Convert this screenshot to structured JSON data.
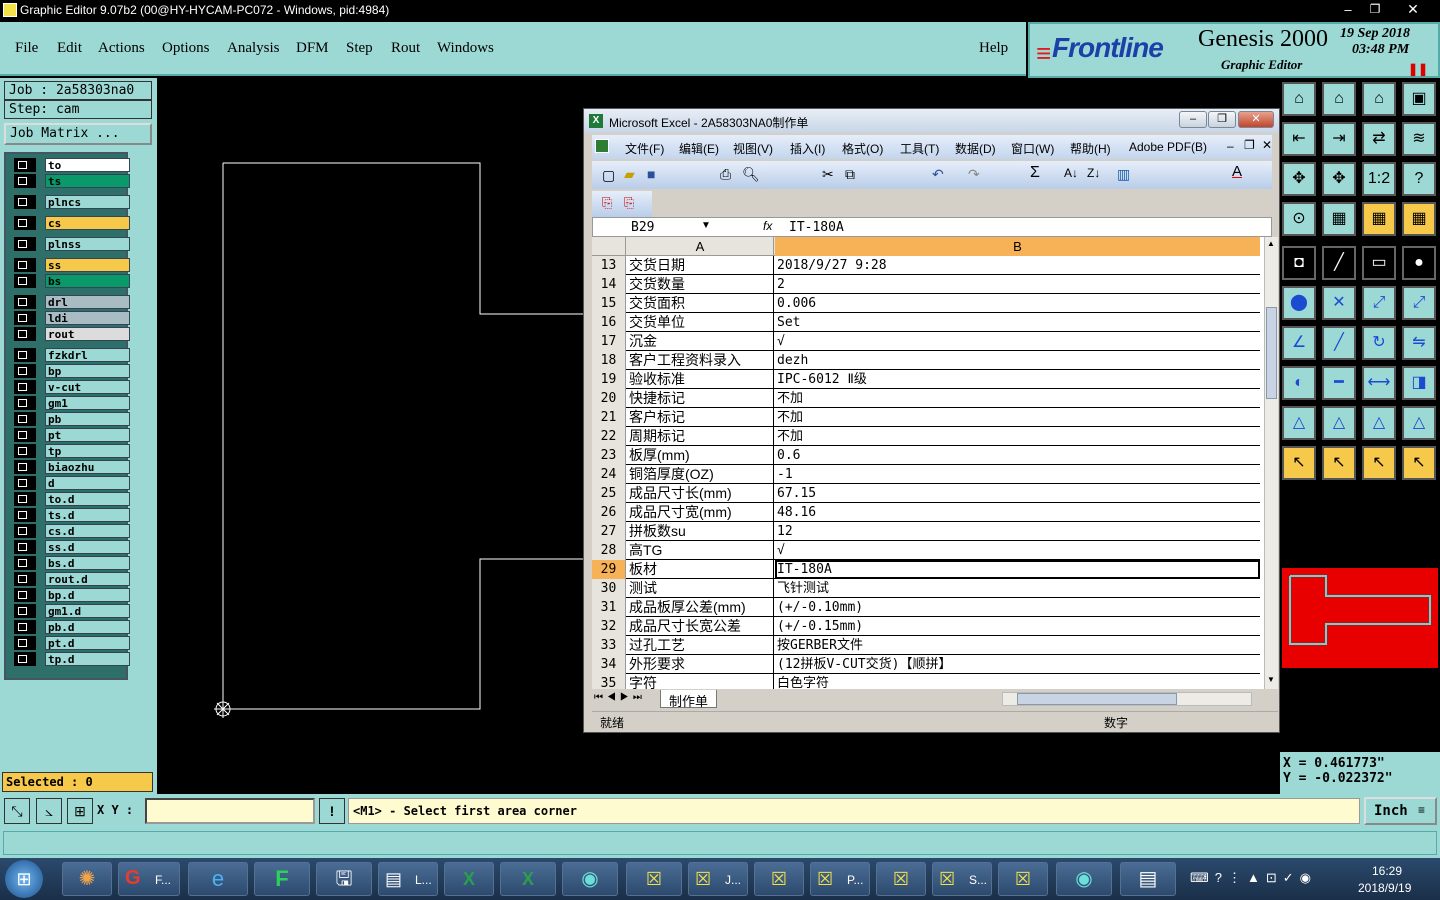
{
  "window": {
    "title": "Graphic Editor 9.07b2 (00@HY-HYCAM-PC072 - Windows, pid:4984)"
  },
  "menu": {
    "items": [
      "File",
      "Edit",
      "Actions",
      "Options",
      "Analysis",
      "DFM",
      "Step",
      "Rout",
      "Windows"
    ],
    "help": "Help"
  },
  "brand": {
    "logo": "Frontline",
    "product": "Genesis 2000",
    "subtitle": "Graphic Editor",
    "date": "19 Sep 2018",
    "time": "03:48 PM"
  },
  "job": {
    "job_label": "Job : 2a58303na0",
    "step_label": "Step: cam",
    "matrix_button": "Job Matrix ..."
  },
  "layers": [
    {
      "name": "to",
      "color": "#ffffff"
    },
    {
      "name": "ts",
      "color": "#0a9a6a"
    },
    {
      "name": "plncs",
      "color": "#9cd9d4"
    },
    {
      "name": "cs",
      "color": "#f7c94b"
    },
    {
      "name": "plnss",
      "color": "#9cd9d4"
    },
    {
      "name": "ss",
      "color": "#f7c94b"
    },
    {
      "name": "bs",
      "color": "#0a9a6a"
    },
    {
      "name": "drl",
      "color": "#a9bcc4"
    },
    {
      "name": "ldi",
      "color": "#a9bcc4"
    },
    {
      "name": "rout",
      "color": "#dcdcdc"
    },
    {
      "name": "fzkdrl",
      "color": "#9cd9d4"
    },
    {
      "name": "bp",
      "color": "#9cd9d4"
    },
    {
      "name": "v-cut",
      "color": "#9cd9d4"
    },
    {
      "name": "gm1",
      "color": "#9cd9d4"
    },
    {
      "name": "pb",
      "color": "#9cd9d4"
    },
    {
      "name": "pt",
      "color": "#9cd9d4"
    },
    {
      "name": "tp",
      "color": "#9cd9d4"
    },
    {
      "name": "biaozhu",
      "color": "#9cd9d4"
    },
    {
      "name": "d",
      "color": "#9cd9d4"
    },
    {
      "name": "to.d",
      "color": "#9cd9d4"
    },
    {
      "name": "ts.d",
      "color": "#9cd9d4"
    },
    {
      "name": "cs.d",
      "color": "#9cd9d4"
    },
    {
      "name": "ss.d",
      "color": "#9cd9d4"
    },
    {
      "name": "bs.d",
      "color": "#9cd9d4"
    },
    {
      "name": "rout.d",
      "color": "#9cd9d4"
    },
    {
      "name": "bp.d",
      "color": "#9cd9d4"
    },
    {
      "name": "gm1.d",
      "color": "#9cd9d4"
    },
    {
      "name": "pb.d",
      "color": "#9cd9d4"
    },
    {
      "name": "pt.d",
      "color": "#9cd9d4"
    },
    {
      "name": "tp.d",
      "color": "#9cd9d4"
    }
  ],
  "selected": "Selected : 0",
  "excel": {
    "title": "Microsoft Excel - 2A58303NA0制作单",
    "menu": [
      "文件(F)",
      "编辑(E)",
      "视图(V)",
      "插入(I)",
      "格式(O)",
      "工具(T)",
      "数据(D)",
      "窗口(W)",
      "帮助(H)",
      "Adobe PDF(B)"
    ],
    "cell_ref": "B29",
    "fx": "fx",
    "formula": "IT-180A",
    "col_a": "A",
    "col_b": "B",
    "rows": [
      {
        "n": "13",
        "a": "交货日期",
        "b": "2018/9/27 9:28"
      },
      {
        "n": "14",
        "a": "交货数量",
        "b": "2"
      },
      {
        "n": "15",
        "a": "交货面积",
        "b": "0.006"
      },
      {
        "n": "16",
        "a": "交货单位",
        "b": "Set"
      },
      {
        "n": "17",
        "a": "沉金",
        "b": "√"
      },
      {
        "n": "18",
        "a": "客户工程资料录入",
        "b": "dezh"
      },
      {
        "n": "19",
        "a": "验收标准",
        "b": "IPC-6012 Ⅱ级"
      },
      {
        "n": "20",
        "a": "快捷标记",
        "b": "不加"
      },
      {
        "n": "21",
        "a": "客户标记",
        "b": "不加"
      },
      {
        "n": "22",
        "a": "周期标记",
        "b": "不加"
      },
      {
        "n": "23",
        "a": "板厚(mm)",
        "b": "0.6"
      },
      {
        "n": "24",
        "a": "铜箔厚度(OZ)",
        "b": "-1"
      },
      {
        "n": "25",
        "a": "成品尺寸长(mm)",
        "b": "67.15"
      },
      {
        "n": "26",
        "a": "成品尺寸宽(mm)",
        "b": "48.16"
      },
      {
        "n": "27",
        "a": "拼板数su",
        "b": "12"
      },
      {
        "n": "28",
        "a": "高TG",
        "b": "√"
      },
      {
        "n": "29",
        "a": "板材",
        "b": "IT-180A"
      },
      {
        "n": "30",
        "a": "测试",
        "b": "飞针测试"
      },
      {
        "n": "31",
        "a": "成品板厚公差(mm)",
        "b": "(+/-0.10mm)"
      },
      {
        "n": "32",
        "a": "成品尺寸长宽公差",
        "b": "(+/-0.15mm)"
      },
      {
        "n": "33",
        "a": "过孔工艺",
        "b": "按GERBER文件"
      },
      {
        "n": "34",
        "a": "外形要求",
        "b": "(12拼板V-CUT交货)【顺拼】"
      },
      {
        "n": "35",
        "a": "字符",
        "b": "白色字符"
      }
    ],
    "sheet_tab": "制作单",
    "status_ready": "就绪",
    "status_num": "数字"
  },
  "coords": {
    "x": "X = 0.461773\"",
    "y": "Y = -0.022372\""
  },
  "bottom": {
    "xy_label": "X Y :",
    "xy_value": "",
    "message": "<M1> - Select first area corner",
    "units": "Inch"
  },
  "taskbar": {
    "time": "16:29",
    "date": "2018/9/19",
    "items": [
      "F...",
      "L...",
      "J...",
      "P...",
      "S..."
    ]
  },
  "colors": {
    "panel": "#9cd9d4",
    "selected_layer": "#f7c94b",
    "profile_red": "#e80000",
    "excel_header_b": "#f7b257"
  }
}
